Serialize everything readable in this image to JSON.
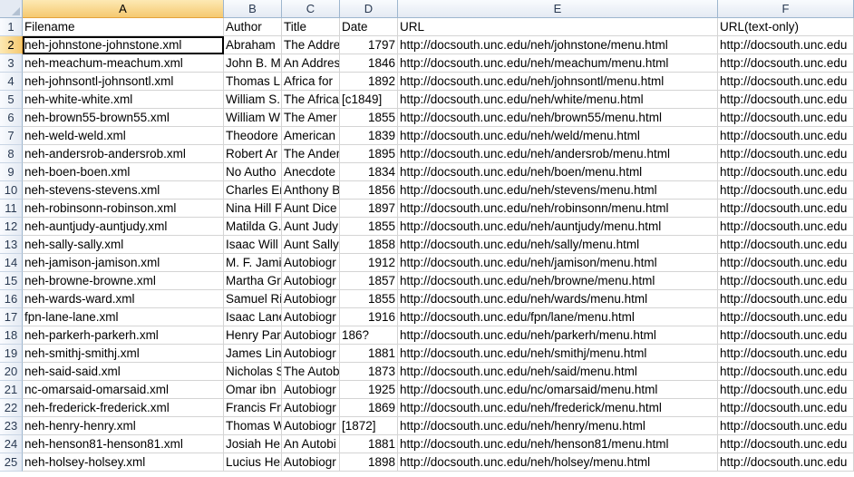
{
  "columns": [
    "A",
    "B",
    "C",
    "D",
    "E",
    "F"
  ],
  "active_cell": {
    "row": 2,
    "col": "A"
  },
  "rows": [
    {
      "n": "1",
      "cells": [
        "Filename",
        "Author",
        "Title",
        "Date",
        "URL",
        "URL(text-only)"
      ]
    },
    {
      "n": "2",
      "cells": [
        "neh-johnstone-johnstone.xml",
        "Abraham",
        "The Addre",
        "1797",
        "http://docsouth.unc.edu/neh/johnstone/menu.html",
        "http://docsouth.unc.edu"
      ]
    },
    {
      "n": "3",
      "cells": [
        "neh-meachum-meachum.xml",
        "John B. M",
        "An Addres",
        "1846",
        "http://docsouth.unc.edu/neh/meachum/menu.html",
        "http://docsouth.unc.edu"
      ]
    },
    {
      "n": "4",
      "cells": [
        "neh-johnsontl-johnsontl.xml",
        "Thomas L.",
        "Africa for",
        "1892",
        "http://docsouth.unc.edu/neh/johnsontl/menu.html",
        "http://docsouth.unc.edu"
      ]
    },
    {
      "n": "5",
      "cells": [
        "neh-white-white.xml",
        "William S.",
        "The Africa",
        "[c1849]",
        "http://docsouth.unc.edu/neh/white/menu.html",
        "http://docsouth.unc.edu"
      ]
    },
    {
      "n": "6",
      "cells": [
        "neh-brown55-brown55.xml",
        "William W",
        "The Amer",
        "1855",
        "http://docsouth.unc.edu/neh/brown55/menu.html",
        "http://docsouth.unc.edu"
      ]
    },
    {
      "n": "7",
      "cells": [
        "neh-weld-weld.xml",
        "Theodore",
        "American",
        "1839",
        "http://docsouth.unc.edu/neh/weld/menu.html",
        "http://docsouth.unc.edu"
      ]
    },
    {
      "n": "8",
      "cells": [
        "neh-andersrob-andersrob.xml",
        "Robert  Ar",
        "The Ander",
        "1895",
        "http://docsouth.unc.edu/neh/andersrob/menu.html",
        "http://docsouth.unc.edu"
      ]
    },
    {
      "n": "9",
      "cells": [
        "neh-boen-boen.xml",
        "No Autho",
        "Anecdote",
        "1834",
        "http://docsouth.unc.edu/neh/boen/menu.html",
        "http://docsouth.unc.edu"
      ]
    },
    {
      "n": "10",
      "cells": [
        "neh-stevens-stevens.xml",
        "Charles Er",
        "Anthony B",
        "1856",
        "http://docsouth.unc.edu/neh/stevens/menu.html",
        "http://docsouth.unc.edu"
      ]
    },
    {
      "n": "11",
      "cells": [
        "neh-robinsonn-robinson.xml",
        "Nina Hill F",
        "Aunt Dice",
        "1897",
        "http://docsouth.unc.edu/neh/robinsonn/menu.html",
        "http://docsouth.unc.edu"
      ]
    },
    {
      "n": "12",
      "cells": [
        "neh-auntjudy-auntjudy.xml",
        "Matilda G.",
        "Aunt Judy",
        "1855",
        "http://docsouth.unc.edu/neh/auntjudy/menu.html",
        "http://docsouth.unc.edu"
      ]
    },
    {
      "n": "13",
      "cells": [
        "neh-sally-sally.xml",
        "Isaac  Will",
        "Aunt Sally",
        "1858",
        "http://docsouth.unc.edu/neh/sally/menu.html",
        "http://docsouth.unc.edu"
      ]
    },
    {
      "n": "14",
      "cells": [
        "neh-jamison-jamison.xml",
        "M. F. Jami",
        "Autobiogr",
        "1912",
        "http://docsouth.unc.edu/neh/jamison/menu.html",
        "http://docsouth.unc.edu"
      ]
    },
    {
      "n": "15",
      "cells": [
        "neh-browne-browne.xml",
        "Martha Gr",
        "Autobiogr",
        "1857",
        "http://docsouth.unc.edu/neh/browne/menu.html",
        "http://docsouth.unc.edu"
      ]
    },
    {
      "n": "16",
      "cells": [
        "neh-wards-ward.xml",
        "Samuel Ri",
        "Autobiogr",
        "1855",
        "http://docsouth.unc.edu/neh/wards/menu.html",
        "http://docsouth.unc.edu"
      ]
    },
    {
      "n": "17",
      "cells": [
        "fpn-lane-lane.xml",
        "Isaac  Lane",
        "Autobiogr",
        "1916",
        "http://docsouth.unc.edu/fpn/lane/menu.html",
        "http://docsouth.unc.edu"
      ]
    },
    {
      "n": "18",
      "cells": [
        "neh-parkerh-parkerh.xml",
        "Henry  Par",
        "Autobiogr",
        "186?",
        "http://docsouth.unc.edu/neh/parkerh/menu.html",
        "http://docsouth.unc.edu"
      ]
    },
    {
      "n": "19",
      "cells": [
        "neh-smithj-smithj.xml",
        "James Linc",
        "Autobiogr",
        "1881",
        "http://docsouth.unc.edu/neh/smithj/menu.html",
        "http://docsouth.unc.edu"
      ]
    },
    {
      "n": "20",
      "cells": [
        "neh-said-said.xml",
        "Nicholas  S",
        "The Autob",
        "1873",
        "http://docsouth.unc.edu/neh/said/menu.html",
        "http://docsouth.unc.edu"
      ]
    },
    {
      "n": "21",
      "cells": [
        "nc-omarsaid-omarsaid.xml",
        "Omar ibn",
        "Autobiogr",
        "1925",
        "http://docsouth.unc.edu/nc/omarsaid/menu.html",
        "http://docsouth.unc.edu"
      ]
    },
    {
      "n": "22",
      "cells": [
        "neh-frederick-frederick.xml",
        "Francis  Fr",
        "Autobiogr",
        "1869",
        "http://docsouth.unc.edu/neh/frederick/menu.html",
        "http://docsouth.unc.edu"
      ]
    },
    {
      "n": "23",
      "cells": [
        "neh-henry-henry.xml",
        "Thomas W",
        "Autobiogr",
        "[1872]",
        "http://docsouth.unc.edu/neh/henry/menu.html",
        "http://docsouth.unc.edu"
      ]
    },
    {
      "n": "24",
      "cells": [
        "neh-henson81-henson81.xml",
        "Josiah  He",
        "An Autobi",
        "1881",
        "http://docsouth.unc.edu/neh/henson81/menu.html",
        "http://docsouth.unc.edu"
      ]
    },
    {
      "n": "25",
      "cells": [
        "neh-holsey-holsey.xml",
        "Lucius Her",
        "Autobiogr",
        "1898",
        "http://docsouth.unc.edu/neh/holsey/menu.html",
        "http://docsouth.unc.edu"
      ]
    }
  ]
}
